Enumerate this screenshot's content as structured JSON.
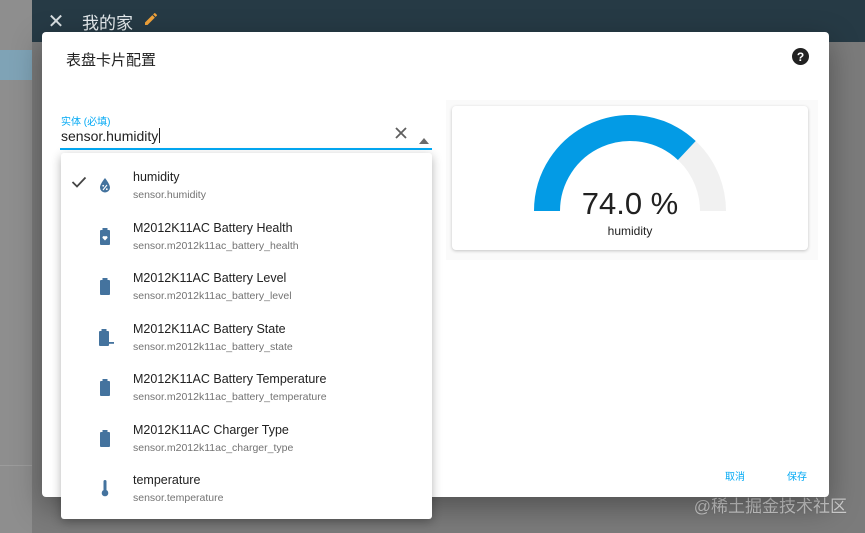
{
  "topbar": {
    "title": "我的家"
  },
  "dialog": {
    "title": "表盘卡片配置",
    "entity_label": "实体 (必填)",
    "entity_value": "sensor.humidity",
    "cancel_label": "取消",
    "save_label": "保存"
  },
  "preview": {
    "value_text": "74.0 %",
    "name": "humidity",
    "level": 0.74,
    "accent": "#039be5"
  },
  "entity_list": [
    {
      "name": "humidity",
      "id": "sensor.humidity",
      "icon": "water-percent-icon",
      "selected": true
    },
    {
      "name": "M2012K11AC Battery Health",
      "id": "sensor.m2012k11ac_battery_health",
      "icon": "battery-heart-icon",
      "selected": false
    },
    {
      "name": "M2012K11AC Battery Level",
      "id": "sensor.m2012k11ac_battery_level",
      "icon": "battery-icon",
      "selected": false
    },
    {
      "name": "M2012K11AC Battery State",
      "id": "sensor.m2012k11ac_battery_state",
      "icon": "battery-minus-icon",
      "selected": false
    },
    {
      "name": "M2012K11AC Battery Temperature",
      "id": "sensor.m2012k11ac_battery_temperature",
      "icon": "battery-icon",
      "selected": false
    },
    {
      "name": "M2012K11AC Charger Type",
      "id": "sensor.m2012k11ac_charger_type",
      "icon": "battery-icon",
      "selected": false
    },
    {
      "name": "temperature",
      "id": "sensor.temperature",
      "icon": "thermometer-icon",
      "selected": false
    }
  ],
  "watermark": "@稀土掘金技术社区",
  "colors": {
    "icon": "#44739e",
    "accent": "#03a9f4",
    "header": "#263a45"
  }
}
